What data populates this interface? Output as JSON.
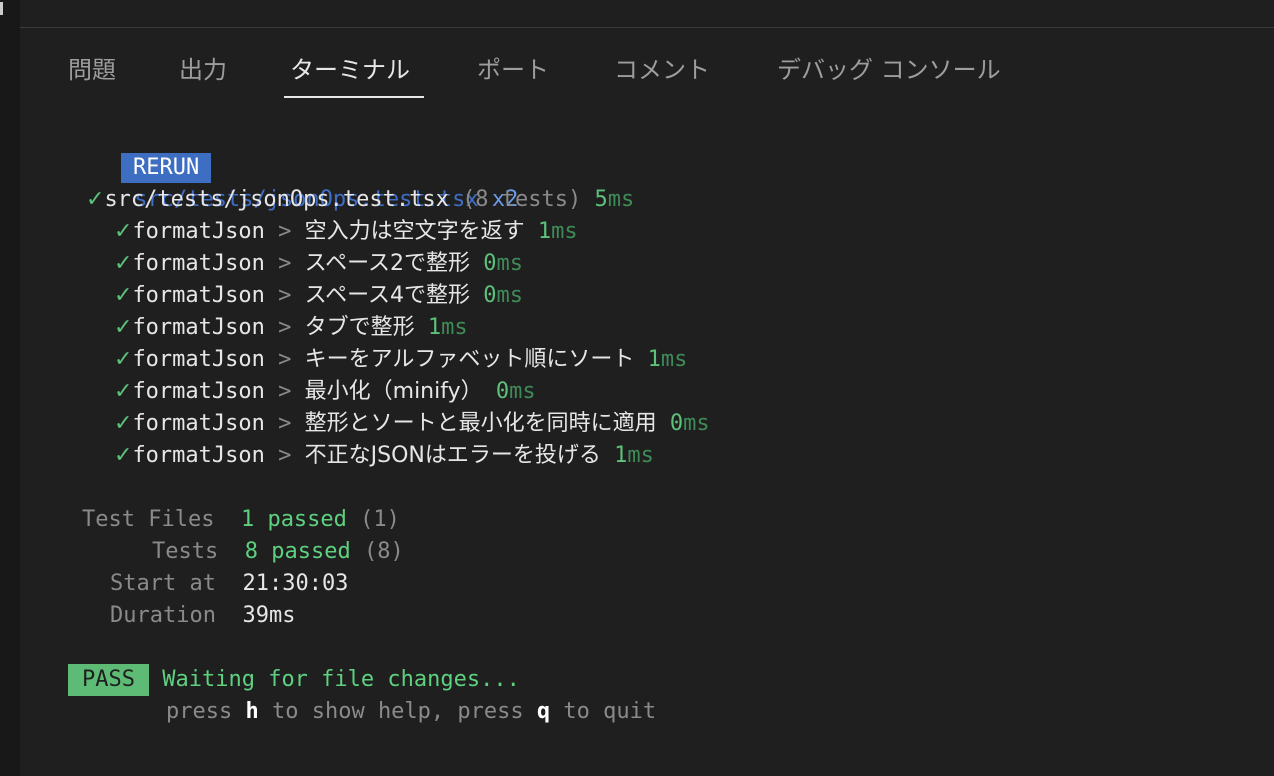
{
  "tabs": [
    {
      "label": "問題"
    },
    {
      "label": "出力"
    },
    {
      "label": "ターミナル"
    },
    {
      "label": "ポート"
    },
    {
      "label": "コメント"
    },
    {
      "label": "デバッグ コンソール"
    }
  ],
  "rerun": {
    "badge": "RERUN",
    "file": "src/tests/jsonOps.test.tsx",
    "count": "x2"
  },
  "suite": {
    "check": "✓",
    "file": "src/tests/jsonOps.test.tsx",
    "count": "(8 tests)",
    "time_num": "5",
    "time_unit": "ms"
  },
  "tests": [
    {
      "check": "✓",
      "group": "formatJson",
      "sep": " > ",
      "name": "空入力は空文字を返す",
      "time_num": "1",
      "time_unit": "ms"
    },
    {
      "check": "✓",
      "group": "formatJson",
      "sep": " > ",
      "name": "スペース2で整形",
      "time_num": "0",
      "time_unit": "ms"
    },
    {
      "check": "✓",
      "group": "formatJson",
      "sep": " > ",
      "name": "スペース4で整形",
      "time_num": "0",
      "time_unit": "ms"
    },
    {
      "check": "✓",
      "group": "formatJson",
      "sep": " > ",
      "name": "タブで整形",
      "time_num": "1",
      "time_unit": "ms"
    },
    {
      "check": "✓",
      "group": "formatJson",
      "sep": " > ",
      "name": "キーをアルファベット順にソート",
      "time_num": "1",
      "time_unit": "ms"
    },
    {
      "check": "✓",
      "group": "formatJson",
      "sep": " > ",
      "name": "最小化（minify）",
      "time_num": "0",
      "time_unit": "ms"
    },
    {
      "check": "✓",
      "group": "formatJson",
      "sep": " > ",
      "name": "整形とソートと最小化を同時に適用",
      "time_num": "0",
      "time_unit": "ms"
    },
    {
      "check": "✓",
      "group": "formatJson",
      "sep": " > ",
      "name": "不正なJSONはエラーを投げる",
      "time_num": "1",
      "time_unit": "ms"
    }
  ],
  "summary": {
    "files_label": "Test Files",
    "files_value": "1 passed",
    "files_total": "(1)",
    "tests_label": "Tests",
    "tests_value": "8 passed",
    "tests_total": "(8)",
    "start_label": "Start at",
    "start_value": "21:30:03",
    "duration_label": "Duration",
    "duration_value": "39ms"
  },
  "status": {
    "badge": "PASS",
    "message": "Waiting for file changes...",
    "hint_1": "press ",
    "hint_key_1": "h",
    "hint_2": " to show help, press ",
    "hint_key_2": "q",
    "hint_3": " to quit"
  }
}
